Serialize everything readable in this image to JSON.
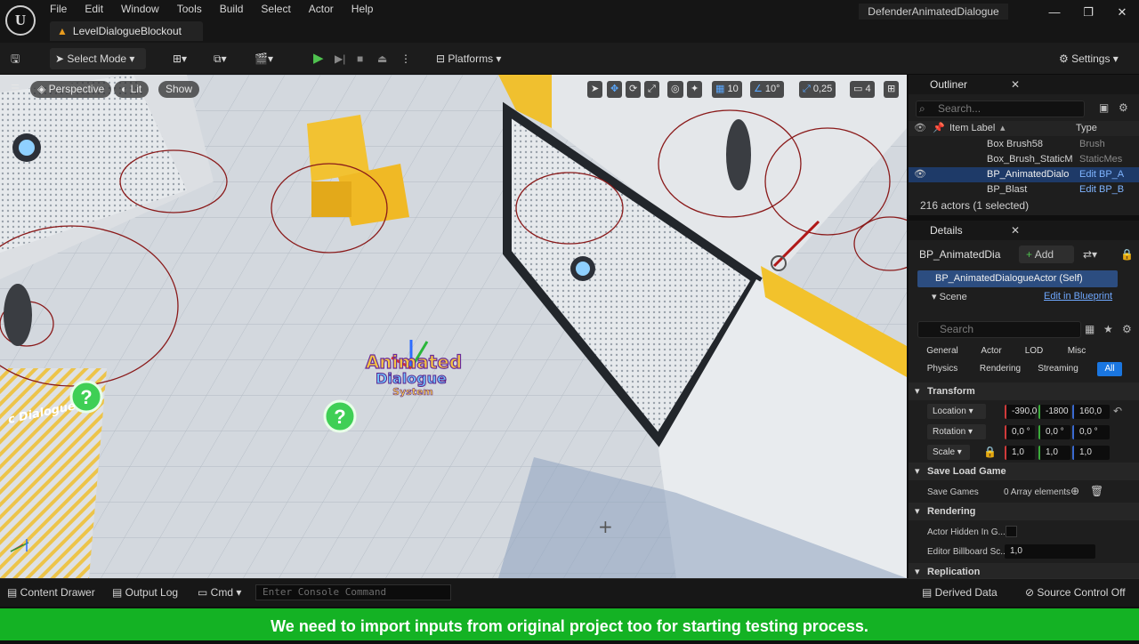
{
  "app": {
    "menu": [
      "File",
      "Edit",
      "Window",
      "Tools",
      "Build",
      "Select",
      "Actor",
      "Help"
    ],
    "level_tab": "LevelDialogueBlockout",
    "project_title": "DefenderAnimatedDialogue"
  },
  "toolbar": {
    "select_mode": "Select Mode",
    "platforms": "Platforms",
    "settings": "Settings"
  },
  "viewport": {
    "perspective": "Perspective",
    "lit": "Lit",
    "show": "Show",
    "grid_snap": "10",
    "rot_snap": "10°",
    "scale_snap": "0,25",
    "cam_speed": "4",
    "logo_line1": "Animated",
    "logo_line2": "Dialogue",
    "logo_line3": "System",
    "partial_text": "c Dialogue"
  },
  "outliner": {
    "title": "Outliner",
    "search_placeholder": "Search...",
    "col_label": "Item Label",
    "col_type": "Type",
    "rows": [
      {
        "label": "Box Brush58",
        "type": "Brush"
      },
      {
        "label": "Box_Brush_StaticM",
        "type": "StaticMes"
      },
      {
        "label": "BP_AnimatedDialo",
        "type": "Edit BP_A"
      },
      {
        "label": "BP_Blast",
        "type": "Edit BP_B"
      }
    ],
    "footer": "216 actors (1 selected)"
  },
  "details": {
    "title": "Details",
    "actor_name": "BP_AnimatedDia",
    "add": "Add",
    "self_row": "BP_AnimatedDialogueActor (Self)",
    "scene": "Scene",
    "edit_in_bp": "Edit in Blueprint",
    "search_placeholder": "Search",
    "filters_row1": [
      "General",
      "Actor",
      "LOD",
      "Misc"
    ],
    "filters_row2": [
      "Physics",
      "Rendering",
      "Streaming",
      "All"
    ],
    "sections": {
      "transform": "Transform",
      "save_load": "Save Load Game",
      "rendering": "Rendering",
      "replication": "Replication"
    },
    "location": {
      "label": "Location",
      "x": "-390,0",
      "y": "-1800",
      "z": "160,0"
    },
    "rotation": {
      "label": "Rotation",
      "x": "0,0 °",
      "y": "0,0 °",
      "z": "0,0 °"
    },
    "scale": {
      "label": "Scale",
      "x": "1,0",
      "y": "1,0",
      "z": "1,0"
    },
    "save_games": "Save Games",
    "array_elements": "0 Array elements",
    "actor_hidden": "Actor Hidden In G...",
    "billboard_scale": "Editor Billboard Sc...",
    "billboard_value": "1,0"
  },
  "bottom": {
    "content_drawer": "Content Drawer",
    "output_log": "Output Log",
    "cmd": "Cmd",
    "console_placeholder": "Enter Console Command",
    "derived_data": "Derived Data",
    "source_control": "Source Control Off"
  },
  "caption": "We need to import inputs from original project too for starting testing process."
}
